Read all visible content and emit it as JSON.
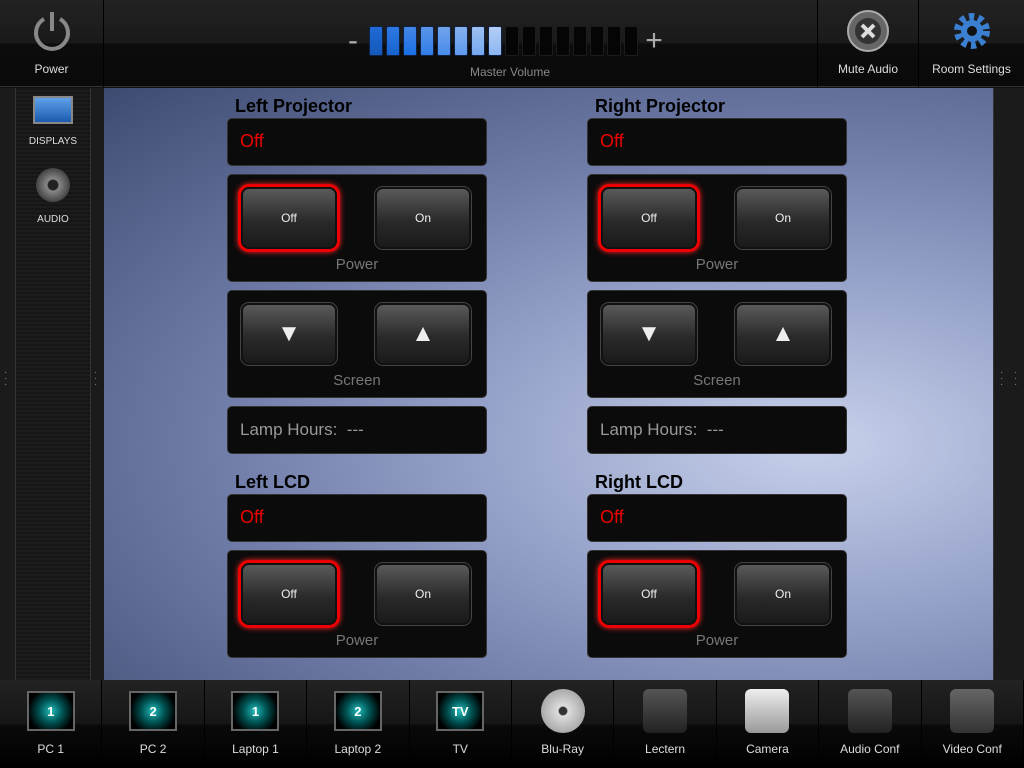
{
  "top": {
    "power_label": "Power",
    "volume_label": "Master Volume",
    "volume_minus": "-",
    "volume_plus": "+",
    "volume_level": 8,
    "volume_segments": 16,
    "mute_label": "Mute Audio",
    "settings_label": "Room Settings"
  },
  "sidebar": {
    "items": [
      {
        "label": "DISPLAYS",
        "icon": "display-icon"
      },
      {
        "label": "AUDIO",
        "icon": "audio-icon"
      }
    ]
  },
  "devices": [
    {
      "title": "Left Projector",
      "status": "Off",
      "off": "Off",
      "on": "On",
      "power_label": "Power",
      "screen_label": "Screen",
      "lamp_label": "Lamp Hours:",
      "lamp_value": "---"
    },
    {
      "title": "Right Projector",
      "status": "Off",
      "off": "Off",
      "on": "On",
      "power_label": "Power",
      "screen_label": "Screen",
      "lamp_label": "Lamp Hours:",
      "lamp_value": "---"
    },
    {
      "title": "Left LCD",
      "status": "Off",
      "off": "Off",
      "on": "On",
      "power_label": "Power"
    },
    {
      "title": "Right LCD",
      "status": "Off",
      "off": "Off",
      "on": "On",
      "power_label": "Power"
    }
  ],
  "sources": [
    {
      "label": "PC 1",
      "badge": "1"
    },
    {
      "label": "PC 2",
      "badge": "2"
    },
    {
      "label": "Laptop 1",
      "badge": "1"
    },
    {
      "label": "Laptop 2",
      "badge": "2"
    },
    {
      "label": "TV",
      "badge": "TV"
    },
    {
      "label": "Blu-Ray"
    },
    {
      "label": "Lectern"
    },
    {
      "label": "Camera"
    },
    {
      "label": "Audio Conf"
    },
    {
      "label": "Video Conf"
    }
  ],
  "colors": {
    "accent_blue": "#2a6fd8",
    "status_red": "#e00000"
  }
}
